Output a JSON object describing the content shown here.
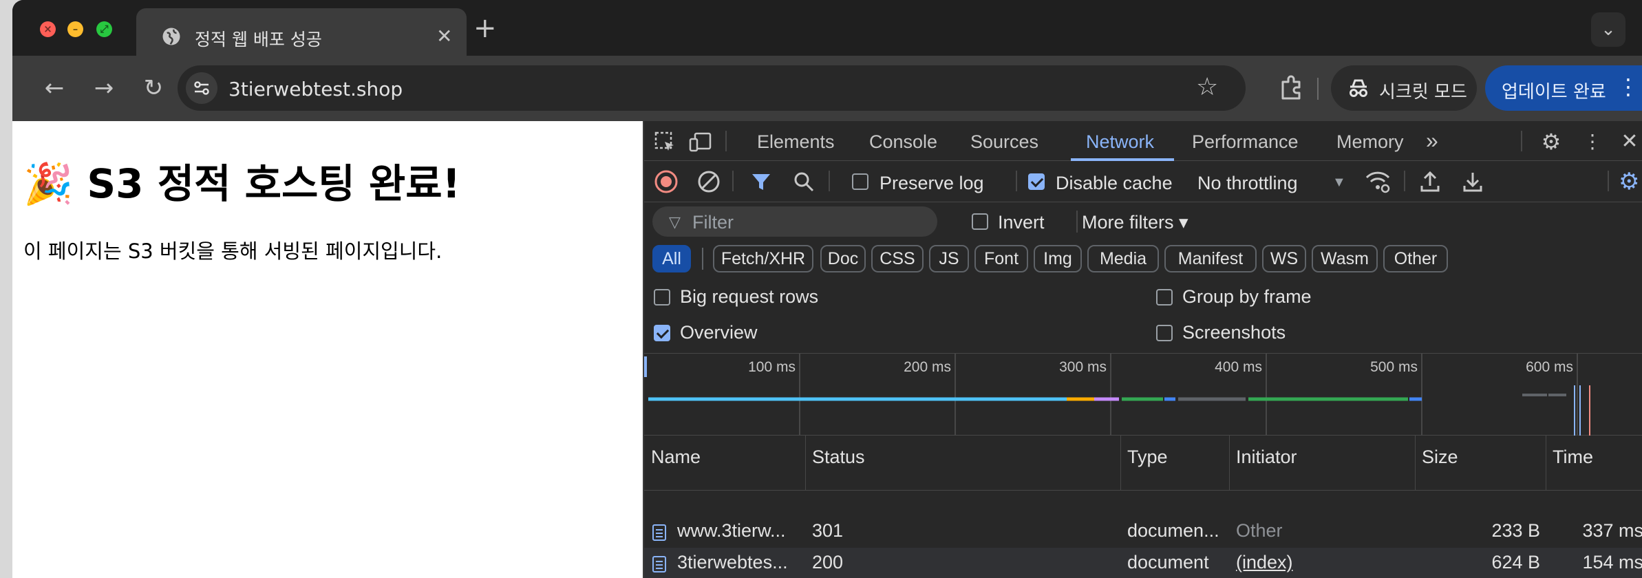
{
  "browser": {
    "tab": {
      "title": "정적 웹 배포 성공",
      "close_glyph": "✕",
      "favicon": "globe-icon"
    },
    "new_tab_glyph": "+",
    "tab_search_glyph": "⌄",
    "nav": {
      "back": "←",
      "forward": "→",
      "reload": "↻"
    },
    "url": "3tierwebtest.shop",
    "bookmark_glyph": "☆",
    "incognito_label": "시크릿 모드",
    "update_label": "업데이트 완료",
    "menu_glyph": "⋮"
  },
  "page": {
    "heading": "🎉 S3 정적 호스팅 완료!",
    "body": "이 페이지는 S3 버킷을 통해 서빙된 페이지입니다."
  },
  "devtools": {
    "tabs": [
      "Elements",
      "Console",
      "Sources",
      "Network",
      "Performance",
      "Memory"
    ],
    "active_tab": "Network",
    "more_tabs_glyph": "»",
    "toolbar": {
      "preserve_log": {
        "label": "Preserve log",
        "checked": false
      },
      "disable_cache": {
        "label": "Disable cache",
        "checked": true
      },
      "throttling": "No throttling"
    },
    "filter": {
      "placeholder": "Filter",
      "invert_label": "Invert",
      "more_filters_label": "More filters ▾"
    },
    "type_filters": [
      "All",
      "Fetch/XHR",
      "Doc",
      "CSS",
      "JS",
      "Font",
      "Img",
      "Media",
      "Manifest",
      "WS",
      "Wasm",
      "Other"
    ],
    "options": {
      "big_request_rows": {
        "label": "Big request rows",
        "checked": false
      },
      "group_by_frame": {
        "label": "Group by frame",
        "checked": false
      },
      "overview": {
        "label": "Overview",
        "checked": true
      },
      "screenshots": {
        "label": "Screenshots",
        "checked": false
      }
    },
    "timeline_ticks": [
      "100 ms",
      "200 ms",
      "300 ms",
      "400 ms",
      "500 ms",
      "600 ms"
    ],
    "columns": [
      "Name",
      "Status",
      "Type",
      "Initiator",
      "Size",
      "Time"
    ],
    "requests": [
      {
        "name": "www.3tierw...",
        "status": "301",
        "type": "documen...",
        "initiator": "Other",
        "size": "233 B",
        "time": "337 ms"
      },
      {
        "name": "3tierwebtes...",
        "status": "200",
        "type": "document",
        "initiator": "(index)",
        "size": "624 B",
        "time": "154 ms"
      }
    ],
    "colors": {
      "accent": "#8ab4f8",
      "record": "#f28b82",
      "bg": "#282828"
    }
  }
}
